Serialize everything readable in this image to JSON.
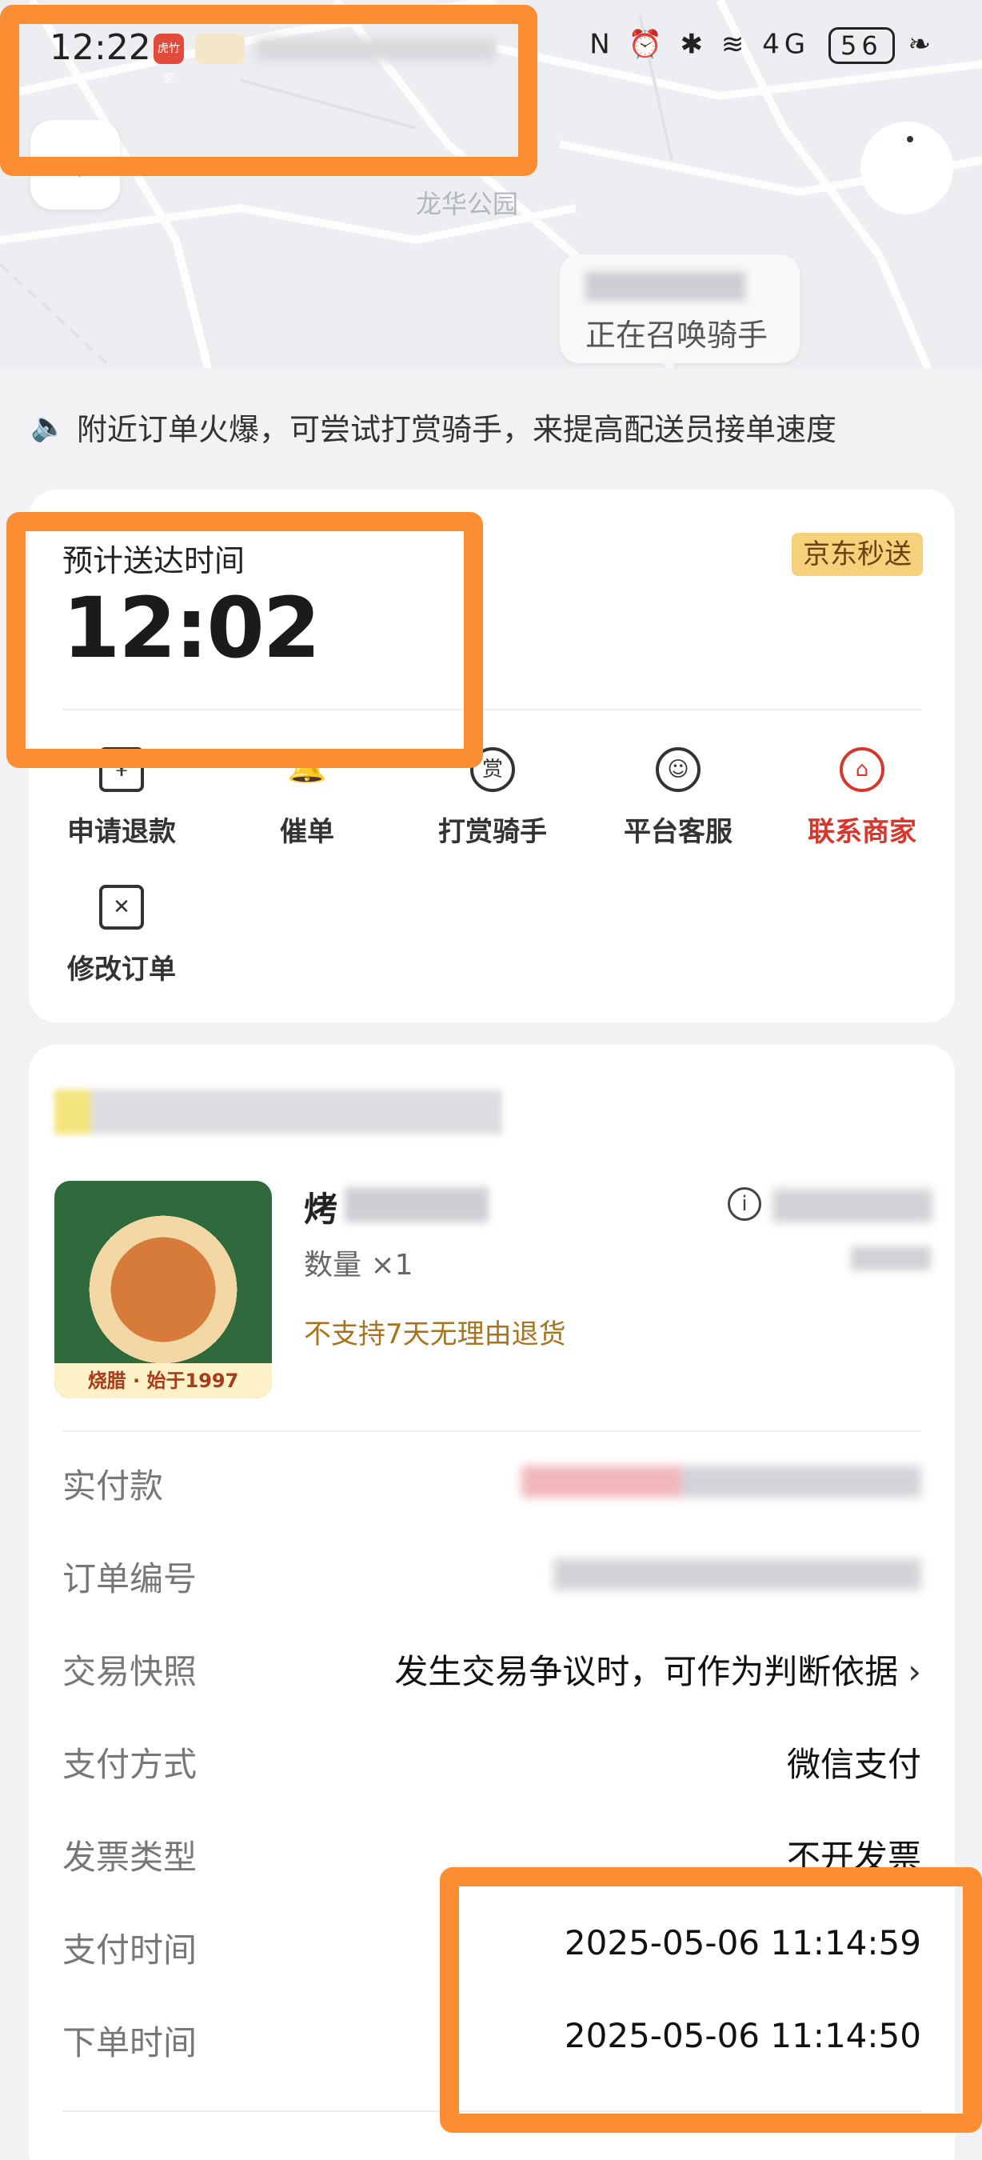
{
  "status_bar": {
    "time": "12:22",
    "app_icon_text": "虎竹家",
    "battery": "56",
    "system_icons": "N ⏰ ✱ ≋ 4G",
    "leaf": "❧"
  },
  "map": {
    "place_label": "龙华公园",
    "rider_status": "正在召唤骑手"
  },
  "notice": {
    "icon": "speaker-icon",
    "text": "附近订单火爆，可尝试打赏骑手，来提高配送员接单速度"
  },
  "delivery": {
    "eta_label": "预计送达时间",
    "eta_time": "12:02",
    "service_badge": "京东秒送"
  },
  "actions": [
    {
      "label": "申请退款",
      "icon": "refund-icon",
      "glyph": "¥",
      "highlight": false
    },
    {
      "label": "催单",
      "icon": "bell-icon",
      "glyph": "🔔",
      "highlight": false
    },
    {
      "label": "打赏骑手",
      "icon": "reward-icon",
      "glyph": "赏",
      "highlight": false
    },
    {
      "label": "平台客服",
      "icon": "smile-icon",
      "glyph": "☺",
      "highlight": false
    },
    {
      "label": "联系商家",
      "icon": "store-chat-icon",
      "glyph": "⌂",
      "highlight": true
    },
    {
      "label": "修改订单",
      "icon": "edit-order-icon",
      "glyph": "✕",
      "highlight": false
    }
  ],
  "product": {
    "image_caption": "烧腊 · 始于1997",
    "name_visible": "烤",
    "quantity": "数量 ×1",
    "return_policy": "不支持7天无理由退货"
  },
  "details": [
    {
      "label": "实付款",
      "value": "",
      "blurred": true
    },
    {
      "label": "订单编号",
      "value": "",
      "blurred": true
    },
    {
      "label": "交易快照",
      "value": "发生交易争议时，可作为判断依据",
      "chevron": "›"
    },
    {
      "label": "支付方式",
      "value": "微信支付"
    },
    {
      "label": "发票类型",
      "value": "不开发票"
    },
    {
      "label": "支付时间",
      "value": "2025-05-06 11:14:59"
    },
    {
      "label": "下单时间",
      "value": "2025-05-06 11:14:50"
    }
  ],
  "colors": {
    "accent_red": "#d9362b",
    "annotation_orange": "#fb8d33",
    "badge_gold": "#f7d07c"
  }
}
